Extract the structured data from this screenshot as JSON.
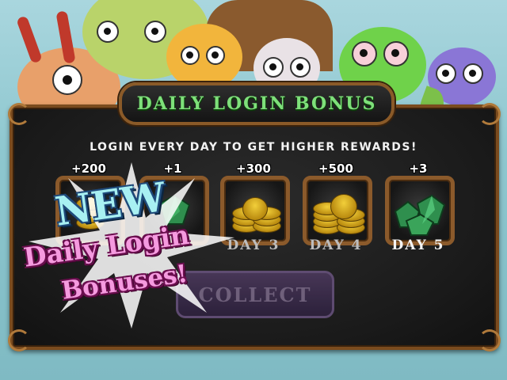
{
  "banner": {
    "title": "DAILY LOGIN BONUS"
  },
  "subtitle": "LOGIN EVERY DAY TO GET HIGHER REWARDS!",
  "days": [
    {
      "amount": "+200",
      "reward": "coins",
      "label": ""
    },
    {
      "amount": "+1",
      "reward": "gems",
      "label": ""
    },
    {
      "amount": "+300",
      "reward": "coins",
      "label": "DAY 3"
    },
    {
      "amount": "+500",
      "reward": "coins",
      "label": "DAY 4"
    },
    {
      "amount": "+3",
      "reward": "gems",
      "label": "DAY 5"
    }
  ],
  "collect_button": {
    "label": "COLLECT"
  },
  "promo": {
    "line1": "NEW",
    "line2": "Daily Login",
    "line3": "Bonuses!"
  },
  "colors": {
    "title_green": "#7ee07a",
    "frame_brown": "#8b5a2b",
    "promo_pink": "#f59adf",
    "promo_cyan": "#a8f0f2"
  },
  "icons": [
    "coin-stack-icon",
    "gem-pile-icon",
    "sparkle-burst-icon"
  ]
}
